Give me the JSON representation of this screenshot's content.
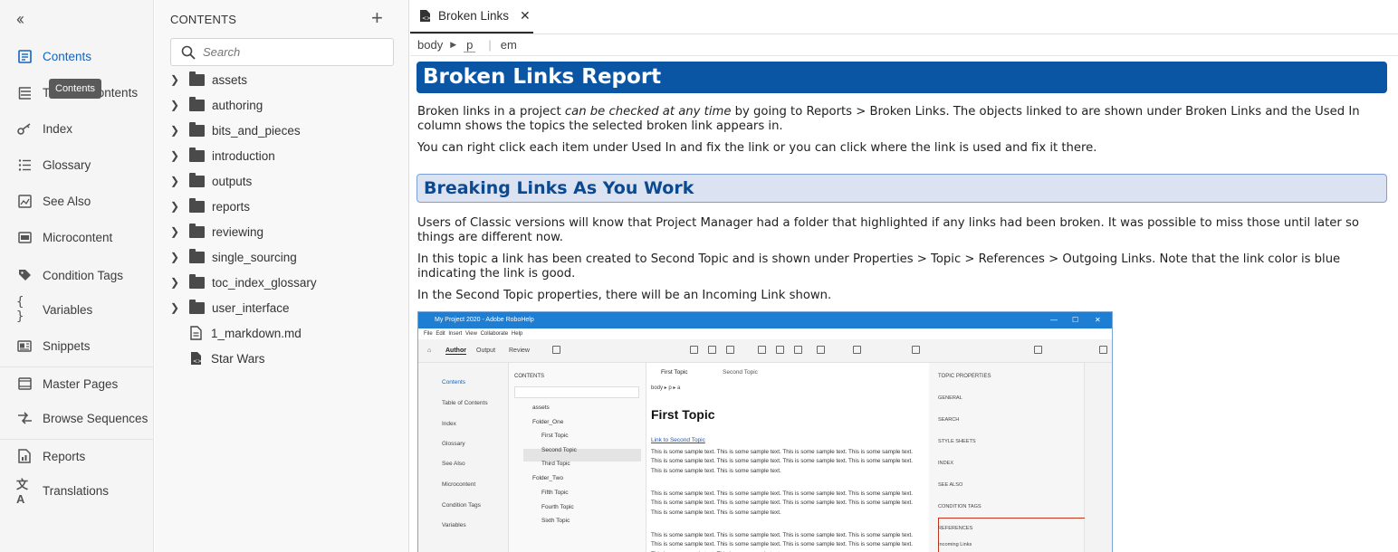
{
  "nav": {
    "collapse_icon": "double-chevron-left-icon",
    "items": [
      {
        "label": "Contents",
        "icon": "contents-icon"
      },
      {
        "label": "Table of Contents",
        "icon": "toc-icon"
      },
      {
        "label": "Index",
        "icon": "key-icon"
      },
      {
        "label": "Glossary",
        "icon": "glossary-icon"
      },
      {
        "label": "See Also",
        "icon": "see-also-icon"
      },
      {
        "label": "Microcontent",
        "icon": "microcontent-icon"
      },
      {
        "label": "Condition Tags",
        "icon": "tag-icon"
      },
      {
        "label": "Variables",
        "icon": "braces-icon"
      },
      {
        "label": "Snippets",
        "icon": "snippet-icon"
      },
      {
        "label": "Master Pages",
        "icon": "master-page-icon"
      },
      {
        "label": "Browse Sequences",
        "icon": "browse-sequence-icon"
      },
      {
        "label": "Reports",
        "icon": "reports-icon"
      },
      {
        "label": "Translations",
        "icon": "translate-icon"
      }
    ],
    "tooltip": "Contents",
    "accent_color": "#1464c0"
  },
  "contents_panel": {
    "title": "CONTENTS",
    "search_placeholder": "Search",
    "items": [
      {
        "label": "assets",
        "type": "folder"
      },
      {
        "label": "authoring",
        "type": "folder"
      },
      {
        "label": "bits_and_pieces",
        "type": "folder"
      },
      {
        "label": "introduction",
        "type": "folder"
      },
      {
        "label": "outputs",
        "type": "folder"
      },
      {
        "label": "reports",
        "type": "folder"
      },
      {
        "label": "reviewing",
        "type": "folder"
      },
      {
        "label": "single_sourcing",
        "type": "folder"
      },
      {
        "label": "toc_index_glossary",
        "type": "folder"
      },
      {
        "label": "user_interface",
        "type": "folder"
      },
      {
        "label": "1_markdown.md",
        "type": "file"
      },
      {
        "label": "Star Wars",
        "type": "file"
      }
    ]
  },
  "editor": {
    "tab_label": "Broken Links",
    "breadcrumb": [
      "body",
      "p",
      "em"
    ],
    "h1": "Broken Links Report",
    "p1_before": "Broken links in a project ",
    "p1_em": "can be checked at any time",
    "p1_after": " by going to Reports > Broken Links. The objects linked to are shown under Broken Links and the Used In column shows the topics the selected broken link appears in.",
    "p2": "You can right click each item under Used In and fix the link or you can click where the link is used and fix it there.",
    "h2": "Breaking Links As You Work",
    "p3": "Users of Classic versions will know that Project Manager had a folder that highlighted if any links had been broken. It was possible to miss those until later so things are different now.",
    "p4": "In this topic a link has been created to Second Topic and is shown under Properties > Topic > References > Outgoing Links. Note that the link color is blue indicating the link is good.",
    "p5": "In the Second Topic properties, there will be an Incoming Link shown.",
    "h1_color": "#0b56a4",
    "h2_color": "#dbe3f3"
  },
  "screenshot": {
    "window_title": "My Project 2020 - Adobe RoboHelp",
    "menu": "File   Edit   Insert   View   Collaborate   Help",
    "modes": [
      "Author",
      "Output",
      "Review"
    ],
    "nav": [
      "Contents",
      "Table of Contents",
      "Index",
      "Glossary",
      "See Also",
      "Microcontent",
      "Condition Tags",
      "Variables"
    ],
    "panel_title": "CONTENTS",
    "tree": [
      "assets",
      "Folder_One",
      "First Topic",
      "Second Topic",
      "Third Topic",
      "Folder_Two",
      "Fifth Topic",
      "Fourth Topic",
      "Sixth Topic"
    ],
    "tabs": [
      "First Topic",
      "Second Topic"
    ],
    "breadcrumb": "body  ▸  p  ▸  a",
    "topic_title": "First Topic",
    "link": "Link to Second Topic",
    "sample": "This is some sample text. This is some sample text. This is some sample text. This is some sample text. This is some sample text. This is some sample text. This is some sample text. This is some sample text. This is some sample text. This is some sample text.",
    "props_title": "TOPIC PROPERTIES",
    "props": [
      "GENERAL",
      "SEARCH",
      "STYLE SHEETS",
      "INDEX",
      "SEE ALSO",
      "CONDITION TAGS",
      "REFERENCES"
    ],
    "incoming": "Incoming Links"
  }
}
